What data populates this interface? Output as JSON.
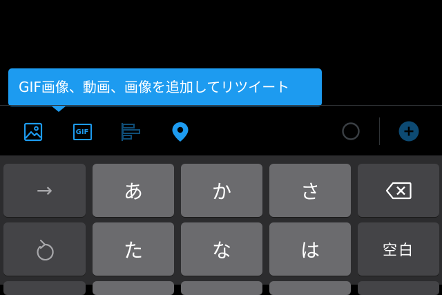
{
  "tooltip": {
    "text": "GIF画像、動画、画像を追加してリツイート"
  },
  "toolbar": {
    "gif_label": "GIF",
    "accent": "#1d9bf0"
  },
  "keyboard": {
    "row1": [
      "→",
      "あ",
      "か",
      "さ",
      "⌫"
    ],
    "row2": [
      "↺",
      "た",
      "な",
      "は",
      "空白"
    ]
  }
}
